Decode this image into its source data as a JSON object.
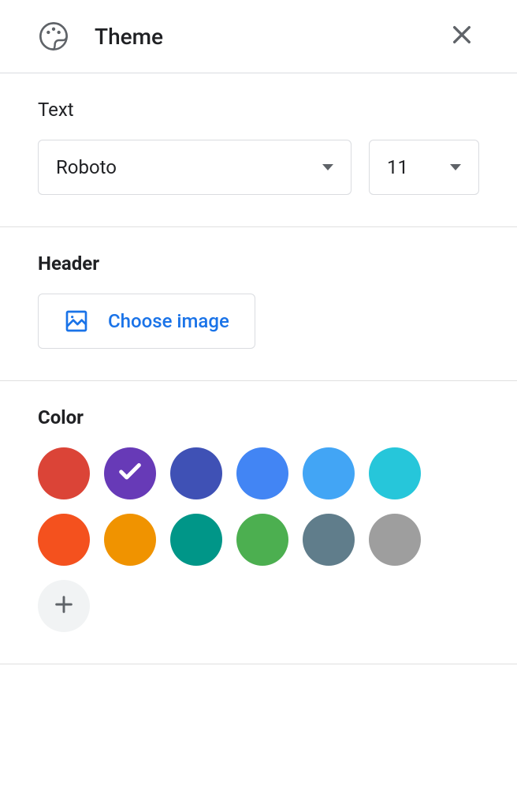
{
  "header": {
    "title": "Theme"
  },
  "text": {
    "label": "Text",
    "font": "Roboto",
    "size": "11"
  },
  "headerSection": {
    "label": "Header",
    "chooseImage": "Choose image"
  },
  "color": {
    "label": "Color",
    "swatches": [
      {
        "hex": "#db4437",
        "selected": false
      },
      {
        "hex": "#673ab7",
        "selected": true
      },
      {
        "hex": "#3f51b5",
        "selected": false
      },
      {
        "hex": "#4285f4",
        "selected": false
      },
      {
        "hex": "#42a5f5",
        "selected": false
      },
      {
        "hex": "#26c6da",
        "selected": false
      },
      {
        "hex": "#f4511e",
        "selected": false
      },
      {
        "hex": "#f09300",
        "selected": false
      },
      {
        "hex": "#009688",
        "selected": false
      },
      {
        "hex": "#4caf50",
        "selected": false
      },
      {
        "hex": "#607d8b",
        "selected": false
      },
      {
        "hex": "#9e9e9e",
        "selected": false
      }
    ]
  }
}
